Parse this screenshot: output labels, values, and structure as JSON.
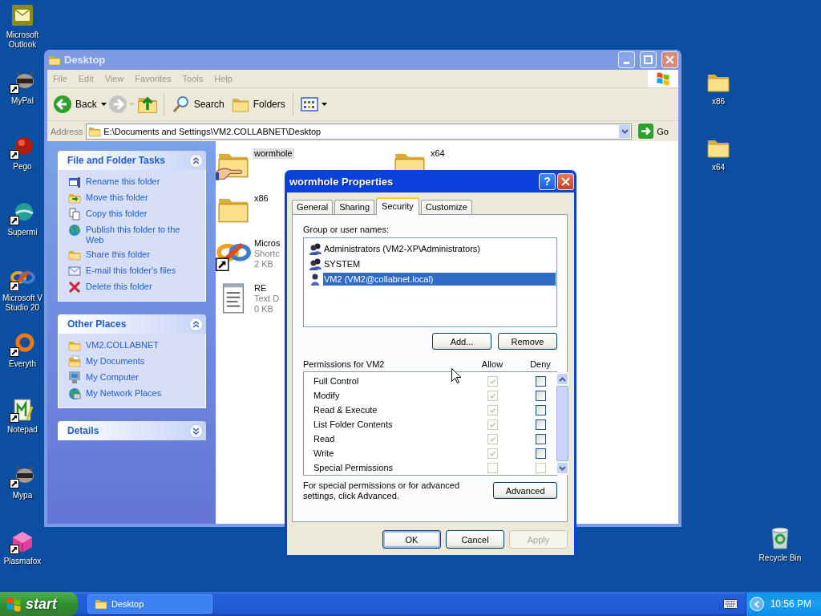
{
  "desktop": {
    "left_icons": [
      {
        "label": "Microsoft Outlook"
      },
      {
        "label": "MyPal"
      },
      {
        "label": "Pego"
      },
      {
        "label": "Supermi"
      },
      {
        "label": "Microsoft V Studio 20"
      },
      {
        "label": "Everyth"
      },
      {
        "label": "Notepad"
      },
      {
        "label": "Mypa"
      },
      {
        "label": "Plasmafox"
      }
    ],
    "right_icons": [
      {
        "label": "x86"
      },
      {
        "label": "x64"
      },
      {
        "label": "Recycle Bin"
      }
    ]
  },
  "explorer": {
    "title": "Desktop",
    "menu": [
      "File",
      "Edit",
      "View",
      "Favorites",
      "Tools",
      "Help"
    ],
    "toolbar": {
      "back": "Back",
      "search": "Search",
      "folders": "Folders"
    },
    "address": {
      "label": "Address",
      "value": "E:\\Documents and Settings\\VM2.COLLABNET\\Desktop",
      "go": "Go"
    },
    "task_panels": [
      {
        "title": "File and Folder Tasks",
        "expanded": true,
        "items": [
          "Rename this folder",
          "Move this folder",
          "Copy this folder",
          "Publish this folder to the Web",
          "Share this folder",
          "E-mail this folder's files",
          "Delete this folder"
        ]
      },
      {
        "title": "Other Places",
        "expanded": true,
        "items": [
          "VM2.COLLABNET",
          "My Documents",
          "My Computer",
          "My Network Places"
        ]
      },
      {
        "title": "Details",
        "expanded": false
      }
    ],
    "files": [
      {
        "name": "wormhole",
        "kind": "shared-folder",
        "selected": true
      },
      {
        "name": "x86",
        "kind": "folder",
        "selected": false
      },
      {
        "name": "Micros",
        "kind": "shortcut",
        "selected": false,
        "details": [
          "Shortc",
          "2 KB"
        ]
      },
      {
        "name": "RE",
        "kind": "text",
        "selected": false,
        "details": [
          "Text D",
          "0 KB"
        ]
      },
      {
        "name": "x64",
        "kind": "folder",
        "selected": false
      }
    ]
  },
  "dialog": {
    "title": "wormhole Properties",
    "help": "?",
    "tabs": [
      {
        "label": "General",
        "selected": false
      },
      {
        "label": "Sharing",
        "selected": false
      },
      {
        "label": "Security",
        "selected": true
      },
      {
        "label": "Customize",
        "selected": false
      }
    ],
    "group_label": "Group or user names:",
    "users": [
      {
        "name": "Administrators (VM2-XP\\Administrators)",
        "kind": "group",
        "selected": false
      },
      {
        "name": "SYSTEM",
        "kind": "group",
        "selected": false
      },
      {
        "name": "VM2 (VM2@collabnet.local)",
        "kind": "user",
        "selected": true
      }
    ],
    "user_buttons": [
      "Add...",
      "Remove"
    ],
    "permissions_label": "Permissions for VM2",
    "columns": [
      "Allow",
      "Deny"
    ],
    "permissions": [
      {
        "name": "Full Control",
        "allow": true,
        "allow_disabled": true,
        "deny": false,
        "deny_disabled": false
      },
      {
        "name": "Modify",
        "allow": true,
        "allow_disabled": true,
        "deny": false,
        "deny_disabled": false
      },
      {
        "name": "Read & Execute",
        "allow": true,
        "allow_disabled": true,
        "deny": false,
        "deny_disabled": false
      },
      {
        "name": "List Folder Contents",
        "allow": true,
        "allow_disabled": true,
        "deny": false,
        "deny_disabled": false
      },
      {
        "name": "Read",
        "allow": true,
        "allow_disabled": true,
        "deny": false,
        "deny_disabled": false
      },
      {
        "name": "Write",
        "allow": true,
        "allow_disabled": true,
        "deny": false,
        "deny_disabled": false
      },
      {
        "name": "Special Permissions",
        "allow": false,
        "allow_disabled": true,
        "deny": false,
        "deny_disabled": true
      }
    ],
    "advanced_note": "For special permissions or for advanced settings, click Advanced.",
    "advanced_button": "Advanced",
    "buttons": [
      {
        "label": "OK",
        "default": true,
        "disabled": false
      },
      {
        "label": "Cancel",
        "default": false,
        "disabled": false
      },
      {
        "label": "Apply",
        "default": false,
        "disabled": true
      }
    ]
  },
  "taskbar": {
    "start": "start",
    "tasks": [
      {
        "label": "Desktop",
        "selected": false
      }
    ],
    "clock": "10:56 PM"
  }
}
